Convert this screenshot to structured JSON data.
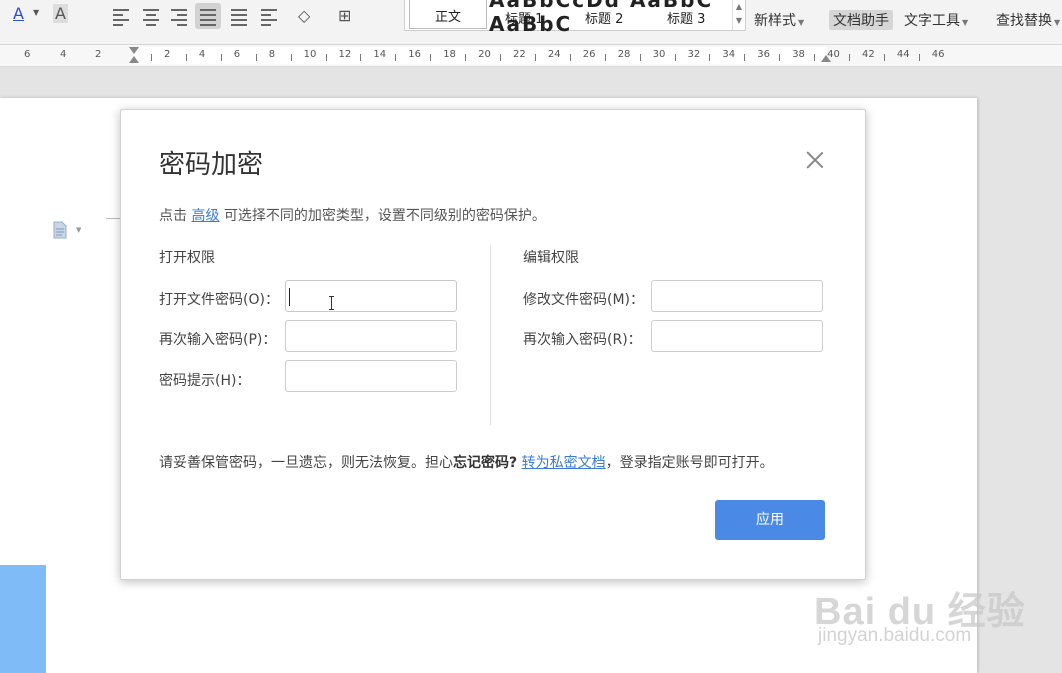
{
  "toolbar": {
    "font_color_glyph": "A",
    "char_shading_glyph": "A",
    "styles": {
      "current": "正文",
      "gallery_preview": "AaBbCcDd AaBbC AaBbC",
      "heading1": "标题 1",
      "heading2": "标题 2",
      "heading3": "标题 3"
    },
    "new_style": "新样式",
    "doc_assistant": "文档助手",
    "text_tools": "文字工具",
    "find_replace": "查找替换"
  },
  "ruler": {
    "left_numbers": [
      "6",
      "4",
      "2"
    ],
    "numbers": [
      "2",
      "4",
      "6",
      "8",
      "10",
      "12",
      "14",
      "16",
      "18",
      "20",
      "22",
      "24",
      "26",
      "28",
      "30",
      "32",
      "34",
      "36",
      "38",
      "40",
      "42",
      "44",
      "46"
    ]
  },
  "dialog": {
    "title": "密码加密",
    "intro_prefix": "点击 ",
    "intro_link": "高级",
    "intro_suffix": " 可选择不同的加密类型，设置不同级别的密码保护。",
    "open_section": {
      "title": "打开权限",
      "password_label": "打开文件密码(O)：",
      "password_value": "",
      "confirm_label": "再次输入密码(P)：",
      "confirm_value": "",
      "hint_label": "密码提示(H)：",
      "hint_value": ""
    },
    "edit_section": {
      "title": "编辑权限",
      "password_label": "修改文件密码(M)：",
      "password_value": "",
      "confirm_label": "再次输入密码(R)：",
      "confirm_value": ""
    },
    "notice_prefix": "请妥善保管密码，一旦遗忘，则无法恢复。担心",
    "notice_bold": "忘记密码?",
    "notice_link": "转为私密文档",
    "notice_suffix": "，登录指定账号即可打开。",
    "apply_button": "应用"
  },
  "watermark": {
    "main": "Bai du 经验",
    "sub": "jingyan.baidu.com"
  },
  "colors": {
    "accent": "#4a8ae6",
    "link": "#3a7bd5",
    "selection_block": "#7fbcf7"
  }
}
